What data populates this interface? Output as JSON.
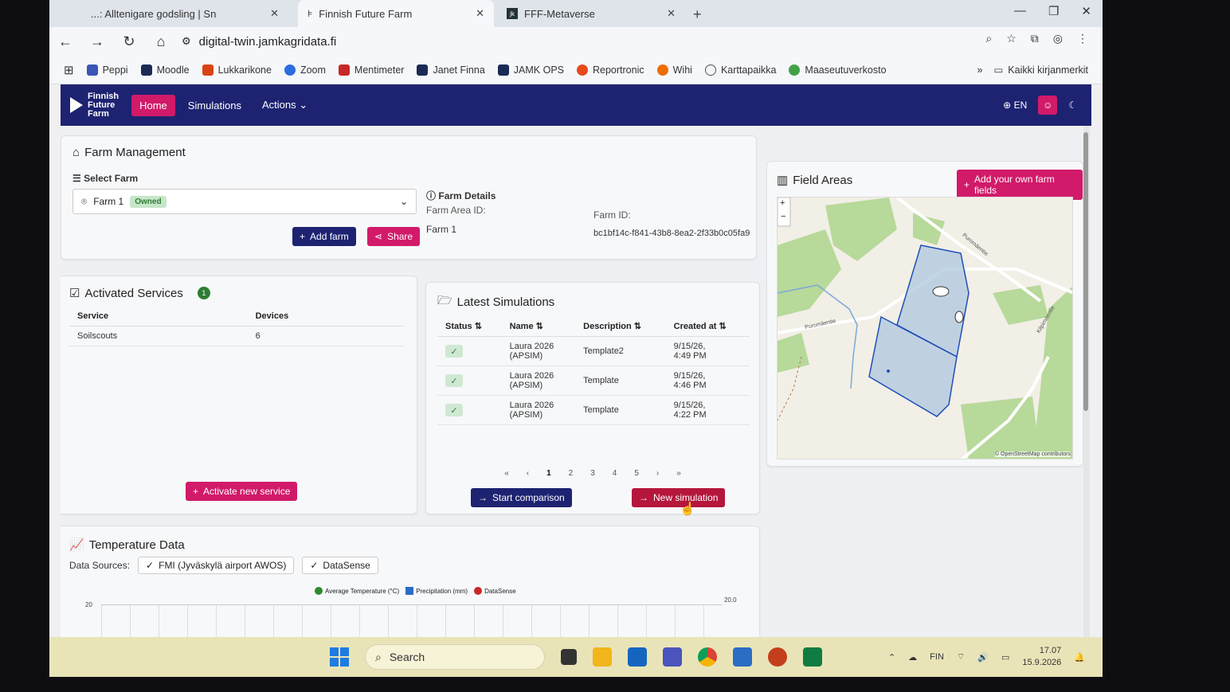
{
  "browser": {
    "tabs": [
      {
        "label": "...: Alltenigare godsling | Sn",
        "active": false
      },
      {
        "label": "Finnish Future Farm",
        "active": true
      },
      {
        "label": "FFF-Metaverse",
        "active": false
      }
    ],
    "url": "digital-twin.jamkagridata.fi",
    "bookmarks": [
      "Peppi",
      "Moodle",
      "Lukkarikone",
      "Zoom",
      "Mentimeter",
      "Janet Finna",
      "JAMK OPS",
      "Reportronic",
      "Wihi",
      "Karttapaikka",
      "Maaseutuverkosto"
    ],
    "all_bookmarks": "Kaikki kirjanmerkit"
  },
  "app": {
    "logo_lines": [
      "Finnish",
      "Future",
      "Farm"
    ],
    "nav": {
      "home": "Home",
      "simulations": "Simulations",
      "actions": "Actions"
    },
    "language": "EN"
  },
  "farm": {
    "title": "Farm Management",
    "select_label": "Select Farm",
    "selected_farm": "Farm 1",
    "badge": "Owned",
    "details_title": "Farm Details",
    "area_id_label": "Farm Area ID:",
    "area_id_value": "Farm 1",
    "farm_id_label": "Farm ID:",
    "farm_id_value": "bc1bf14c-f841-43b8-8ea2-2f33b0c05fa9",
    "add_farm": "Add farm",
    "share": "Share"
  },
  "services": {
    "title": "Activated Services",
    "count": "1",
    "col_service": "Service",
    "col_devices": "Devices",
    "rows": [
      {
        "service": "Soilscouts",
        "devices": "6"
      }
    ],
    "activate": "Activate new service"
  },
  "simulations": {
    "title": "Latest Simulations",
    "cols": {
      "status": "Status",
      "name": "Name",
      "description": "Description",
      "created": "Created at"
    },
    "rows": [
      {
        "name1": "Laura 2026",
        "name2": "(APSIM)",
        "description": "Template2",
        "created1": "9/15/26,",
        "created2": "4:49 PM"
      },
      {
        "name1": "Laura 2026",
        "name2": "(APSIM)",
        "description": "Template",
        "created1": "9/15/26,",
        "created2": "4:46 PM"
      },
      {
        "name1": "Laura 2026",
        "name2": "(APSIM)",
        "description": "Template",
        "created1": "9/15/26,",
        "created2": "4:22 PM"
      }
    ],
    "pages": [
      "1",
      "2",
      "3",
      "4",
      "5"
    ],
    "current_page": "1",
    "start_comparison": "Start comparison",
    "new_simulation": "New simulation"
  },
  "field": {
    "title": "Field Areas",
    "add_fields": "Add your own farm fields",
    "attribution": "© OpenStreetMap contributors",
    "road_label_1": "Puromäentie",
    "road_label_2": "Puromäentie",
    "road_label_3": "Kilpimäentie"
  },
  "temperature": {
    "title": "Temperature Data",
    "sources_label": "Data Sources:",
    "sources": [
      "FMI (Jyväskylä airport AWOS)",
      "DataSense"
    ],
    "legend": [
      "Average Temperature (°C)",
      "Precipitation (mm)",
      "DataSense"
    ],
    "y_left": "20",
    "y_right": "20.0"
  },
  "taskbar": {
    "search": "Search",
    "lang": "FIN",
    "time": "17.07",
    "date": "15.9.2026"
  },
  "colors": {
    "navy": "#1d2371",
    "pink": "#d21a6a",
    "red": "#b5163c"
  }
}
